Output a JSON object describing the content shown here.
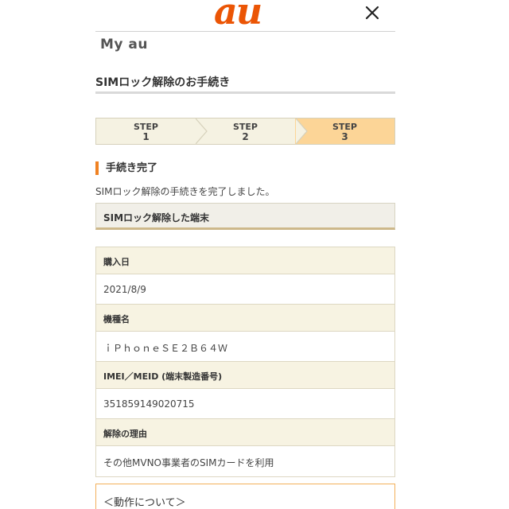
{
  "header": {
    "logo_text": "au",
    "brand": "My au"
  },
  "page": {
    "title": "SIMロック解除のお手続き"
  },
  "steps": [
    {
      "label": "STEP",
      "num": "1",
      "active": false
    },
    {
      "label": "STEP",
      "num": "2",
      "active": false
    },
    {
      "label": "STEP",
      "num": "3",
      "active": true
    }
  ],
  "section": {
    "heading": "手続き完了",
    "message": "SIMロック解除の手続きを完了しました。",
    "device_box": "SIMロック解除した端末"
  },
  "details": {
    "purchase_date_label": "購入日",
    "purchase_date": "2021/8/9",
    "model_label": "機種名",
    "model": "ｉＰｈｏｎｅＳＥ２Ｂ６４Ｗ",
    "imei_label": "IMEI／MEID (端末製造番号)",
    "imei": "351859149020715",
    "reason_label": "解除の理由",
    "reason": "その他MVNO事業者のSIMカードを利用"
  },
  "notice": {
    "text": "＜動作について＞"
  },
  "colors": {
    "brand_orange": "#eb5505",
    "accent_orange": "#f08223",
    "active_step": "#fcd597"
  }
}
